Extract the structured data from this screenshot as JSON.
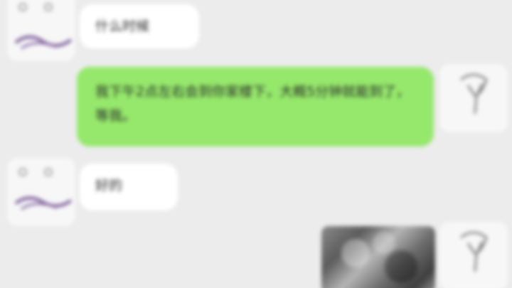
{
  "messages": [
    {
      "side": "left",
      "text": "什么时候"
    },
    {
      "side": "right",
      "text": "我下午2点左右会到你家楼下，大概5分钟就能到了，等我。"
    },
    {
      "side": "left",
      "text": "好的"
    },
    {
      "side": "right",
      "type": "image"
    }
  ],
  "avatars": {
    "left_icon": "cartoon-face-icon",
    "right_icon": "bulb-sketch-icon"
  },
  "colors": {
    "background": "#ececec",
    "outgoing_bubble": "#95e86b",
    "incoming_bubble": "#ffffff"
  }
}
